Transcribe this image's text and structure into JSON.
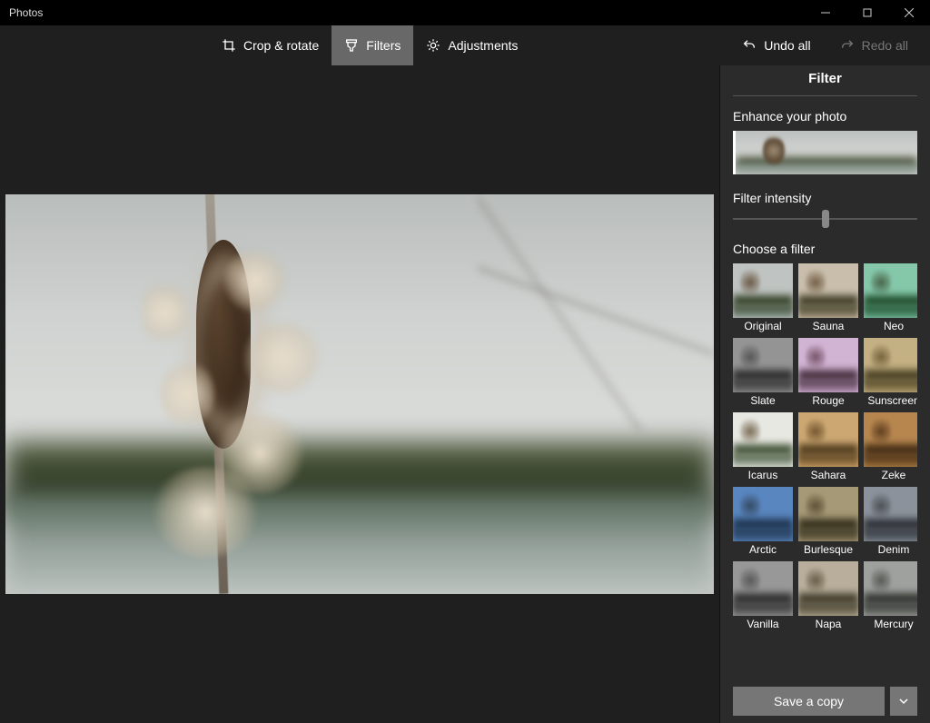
{
  "window": {
    "title": "Photos"
  },
  "toolbar": {
    "crop_label": "Crop & rotate",
    "filters_label": "Filters",
    "adjustments_label": "Adjustments",
    "undo_label": "Undo all",
    "redo_label": "Redo all",
    "active_tab": "Filters",
    "redo_enabled": false
  },
  "panel": {
    "title": "Filter",
    "enhance_label": "Enhance your photo",
    "intensity_label": "Filter intensity",
    "intensity_value": 50,
    "choose_label": "Choose a filter",
    "save_label": "Save a copy"
  },
  "filters": [
    {
      "name": "Original",
      "sky": "#bfc3c1",
      "land": "#3c4a30",
      "water": "#8a9a92",
      "cat": "#6a5844",
      "tint": "transparent"
    },
    {
      "name": "Sauna",
      "sky": "#d4cfc5",
      "land": "#4a4a34",
      "water": "#a39a88",
      "cat": "#7a6650",
      "tint": "rgba(200,170,120,.25)"
    },
    {
      "name": "Neo",
      "sky": "#a7d5c2",
      "land": "#2f5a3a",
      "water": "#6fa48c",
      "cat": "#5a6a52",
      "tint": "rgba(80,200,150,.3)"
    },
    {
      "name": "Slate",
      "sky": "#b6b6b6",
      "land": "#3c3c3c",
      "water": "#8a8a8a",
      "cat": "#6a6a6a",
      "tint": "rgba(120,120,120,.35)"
    },
    {
      "name": "Rouge",
      "sky": "#d9c6dc",
      "land": "#4f3a46",
      "water": "#b49ab4",
      "cat": "#7a5a6a",
      "tint": "rgba(220,160,220,.25)"
    },
    {
      "name": "Sunscreen",
      "sky": "#cbbf9e",
      "land": "#514a30",
      "water": "#a69870",
      "cat": "#7a6a48",
      "tint": "rgba(230,200,130,.35)"
    },
    {
      "name": "Icarus",
      "sky": "#e7e8e6",
      "land": "#4a5a40",
      "water": "#b7c0b8",
      "cat": "#7a6a55",
      "tint": "rgba(255,255,240,.25)"
    },
    {
      "name": "Sahara",
      "sky": "#d8c19a",
      "land": "#5a4a2c",
      "water": "#b79a6a",
      "cat": "#7a623e",
      "tint": "rgba(220,170,90,.4)"
    },
    {
      "name": "Zeke",
      "sky": "#caa877",
      "land": "#4f3c22",
      "water": "#a07e4e",
      "cat": "#6a4e30",
      "tint": "rgba(200,140,60,.45)"
    },
    {
      "name": "Arctic",
      "sky": "#7da4cc",
      "land": "#2e4458",
      "water": "#5a7a9a",
      "cat": "#4a5a6a",
      "tint": "rgba(90,150,220,.45)"
    },
    {
      "name": "Burlesque",
      "sky": "#bcb49a",
      "land": "#3f3b28",
      "water": "#8a826a",
      "cat": "#6a5e44",
      "tint": "rgba(180,160,110,.4)"
    },
    {
      "name": "Denim",
      "sky": "#a9adb2",
      "land": "#3a3e42",
      "water": "#7a8088",
      "cat": "#5a5e60",
      "tint": "rgba(130,140,160,.35)"
    },
    {
      "name": "Vanilla",
      "sky": "#b2b2b2",
      "land": "#3a3a3a",
      "water": "#888888",
      "cat": "#666666",
      "tint": "rgba(150,150,150,.35)"
    },
    {
      "name": "Napa",
      "sky": "#c6beb0",
      "land": "#4a4636",
      "water": "#9a927e",
      "cat": "#6e6450",
      "tint": "rgba(200,185,155,.3)"
    },
    {
      "name": "Mercury",
      "sky": "#b5b7b4",
      "land": "#3e403c",
      "water": "#8c8e8a",
      "cat": "#646560",
      "tint": "rgba(150,155,148,.3)"
    }
  ]
}
